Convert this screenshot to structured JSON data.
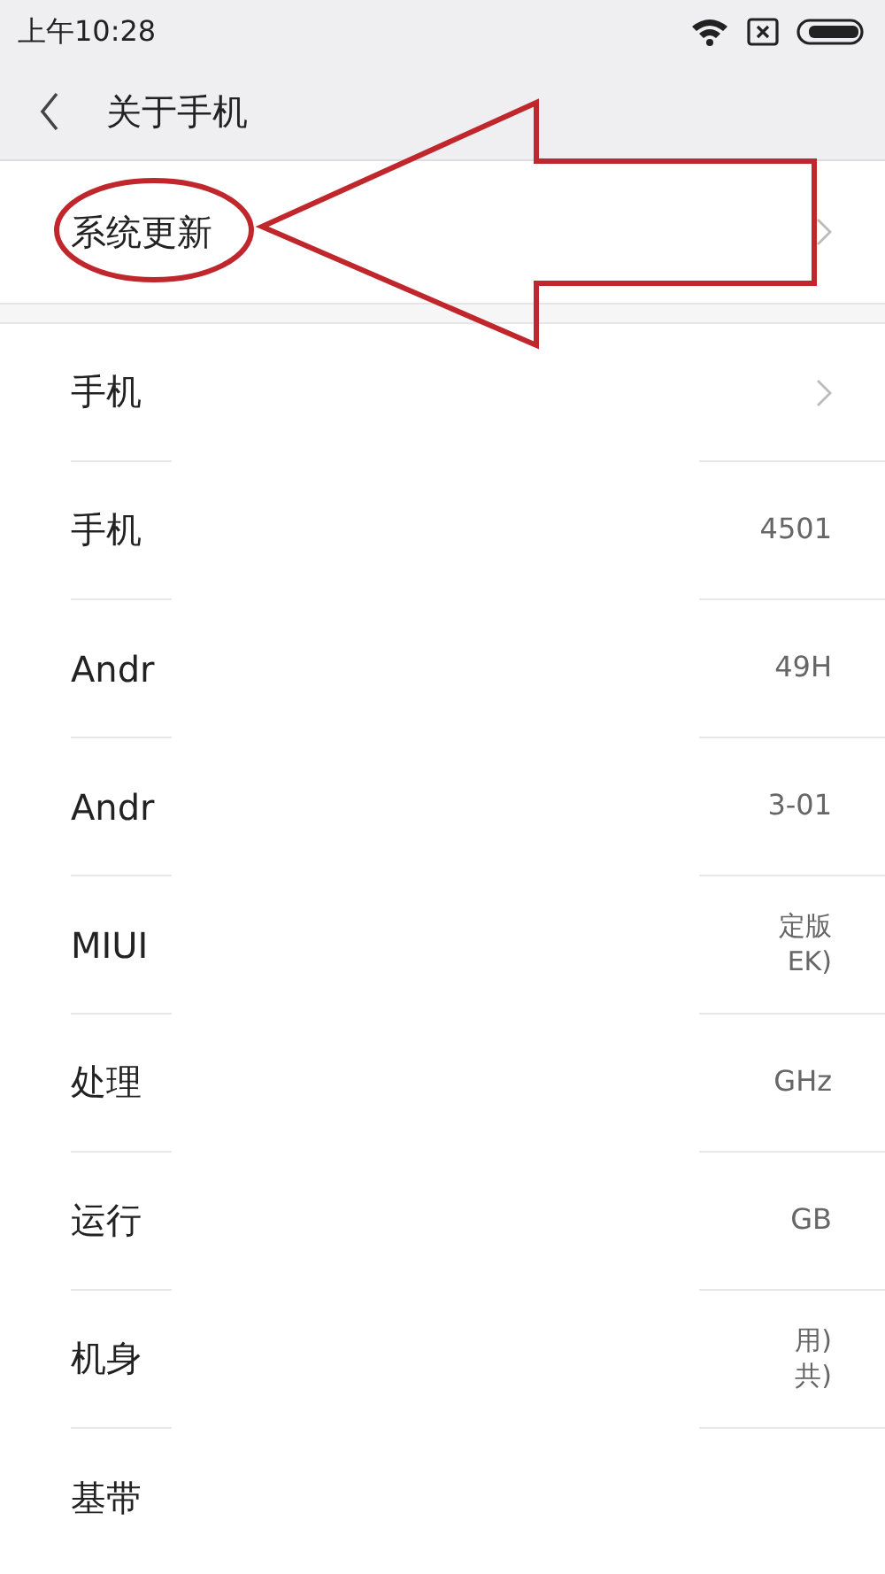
{
  "status_bar": {
    "time": "上午10:28"
  },
  "header": {
    "title": "关于手机"
  },
  "update_item": {
    "label": "系统更新",
    "chevron": true
  },
  "rows": [
    {
      "label": "手机",
      "chevron": true
    },
    {
      "label": "手机",
      "values": [
        "4501"
      ],
      "chevron": false
    },
    {
      "label": "Andr",
      "values": [
        "49H"
      ],
      "chevron": false
    },
    {
      "label": "Andr",
      "values": [
        "3-01"
      ],
      "chevron": false
    },
    {
      "label": "MIUI",
      "values": [
        "定版",
        "EK)"
      ],
      "chevron": false
    },
    {
      "label": "处理",
      "values": [
        "GHz"
      ],
      "chevron": false
    },
    {
      "label": "运行",
      "values": [
        "GB"
      ],
      "chevron": false
    },
    {
      "label": "机身",
      "values": [
        "用)",
        "共)"
      ],
      "chevron": false
    },
    {
      "label": "基带",
      "chevron": false
    }
  ]
}
